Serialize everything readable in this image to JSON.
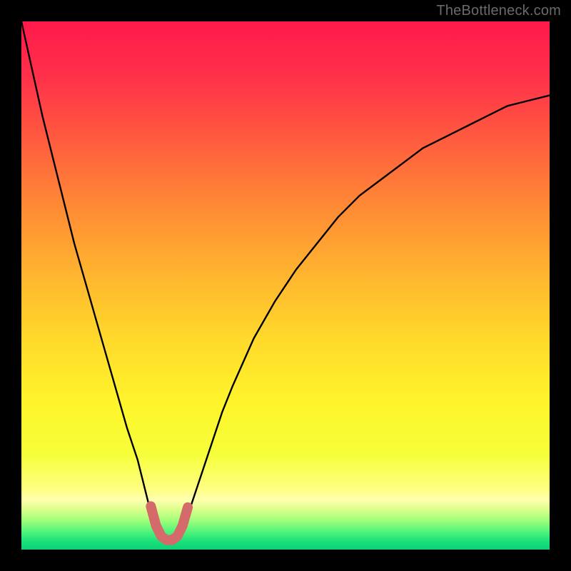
{
  "watermark": "TheBottleneck.com",
  "colors": {
    "frame": "#000000",
    "curve": "#000000",
    "curve_accent": "#d46a6a",
    "gradient_stops": [
      {
        "offset": 0.0,
        "color": "#ff1a4b"
      },
      {
        "offset": 0.1,
        "color": "#ff2f4a"
      },
      {
        "offset": 0.22,
        "color": "#ff5a3f"
      },
      {
        "offset": 0.35,
        "color": "#ff8a35"
      },
      {
        "offset": 0.48,
        "color": "#ffb52f"
      },
      {
        "offset": 0.6,
        "color": "#ffd92b"
      },
      {
        "offset": 0.72,
        "color": "#fff42b"
      },
      {
        "offset": 0.82,
        "color": "#f6ff3a"
      },
      {
        "offset": 0.885,
        "color": "#ffff82"
      },
      {
        "offset": 0.905,
        "color": "#ffffb0"
      },
      {
        "offset": 0.925,
        "color": "#d9ff8a"
      },
      {
        "offset": 0.945,
        "color": "#9fff7a"
      },
      {
        "offset": 0.965,
        "color": "#55f57a"
      },
      {
        "offset": 0.985,
        "color": "#18e07a"
      },
      {
        "offset": 1.0,
        "color": "#0fcf78"
      }
    ]
  },
  "chart_data": {
    "type": "line",
    "title": "",
    "xlabel": "",
    "ylabel": "",
    "xlim": [
      0,
      100
    ],
    "ylim": [
      0,
      100
    ],
    "series": [
      {
        "name": "bottleneck-curve",
        "x": [
          0,
          2,
          4,
          6,
          8,
          10,
          12,
          14,
          16,
          18,
          20,
          21,
          22,
          23,
          24,
          25,
          26,
          27,
          28,
          29,
          30,
          31,
          32,
          34,
          36,
          38,
          40,
          44,
          48,
          52,
          56,
          60,
          64,
          68,
          72,
          76,
          80,
          84,
          88,
          92,
          96,
          100
        ],
        "y": [
          100,
          91,
          82,
          74,
          66,
          58,
          51,
          44,
          37,
          30,
          23,
          20,
          17,
          13,
          9,
          5,
          3,
          2,
          2,
          2,
          3,
          5,
          8,
          14,
          20,
          26,
          31,
          40,
          47,
          53,
          58,
          63,
          67,
          70,
          73,
          76,
          78,
          80,
          82,
          84,
          85,
          86
        ]
      },
      {
        "name": "curve-accent-segment",
        "x": [
          24.5,
          25.5,
          26.5,
          27.5,
          28.5,
          29.5,
          30.5,
          31.5
        ],
        "y": [
          8.2,
          4.5,
          2.5,
          1.8,
          1.8,
          2.5,
          4.5,
          8.0
        ]
      }
    ]
  }
}
